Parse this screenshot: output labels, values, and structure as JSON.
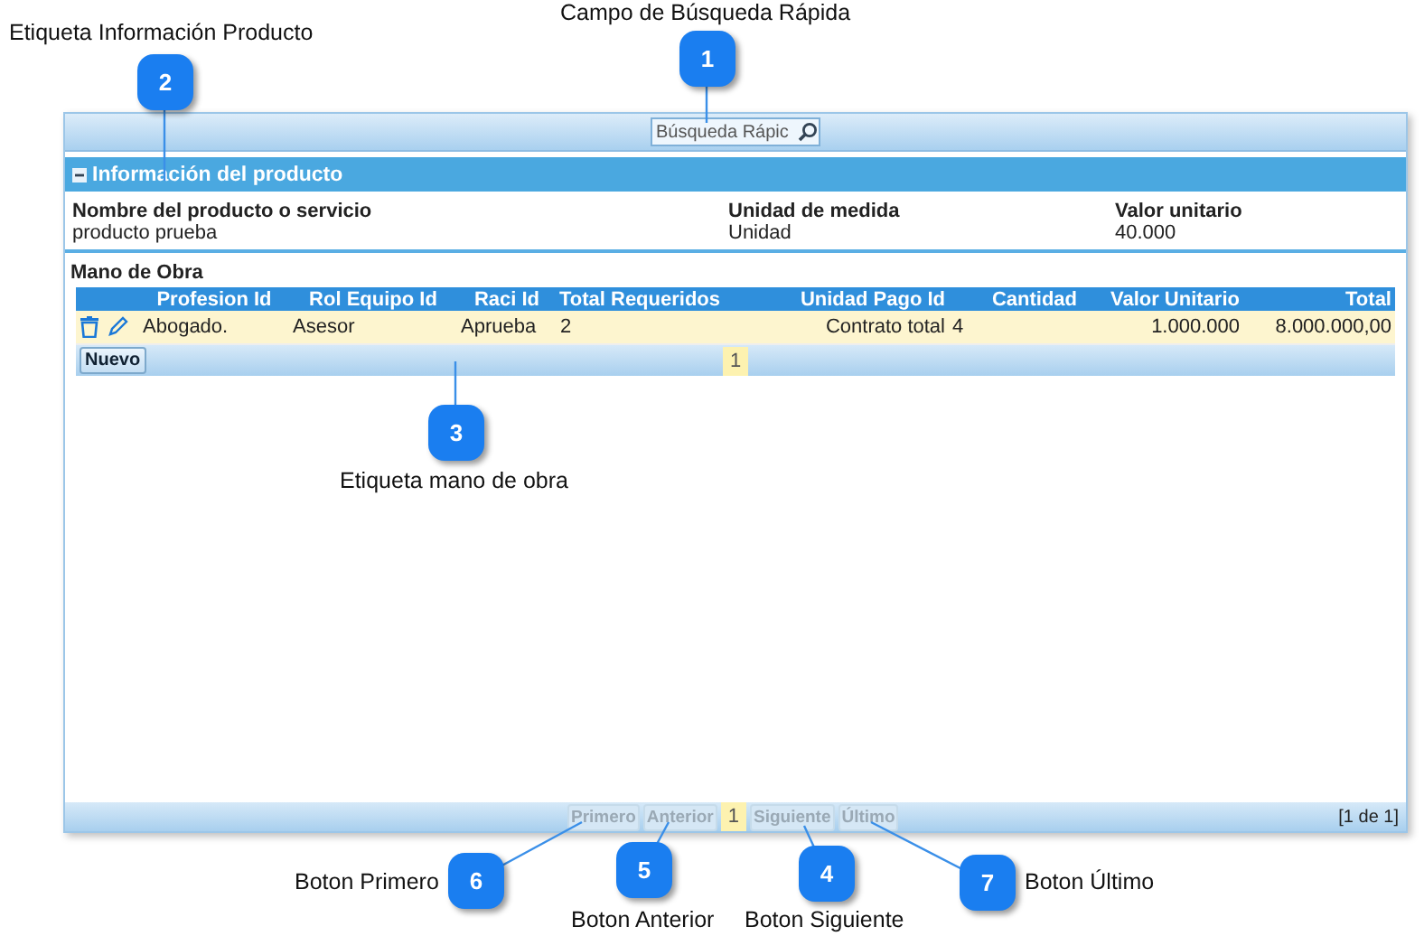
{
  "toolbar": {
    "search": {
      "placeholder": "Búsqueda Rápic"
    }
  },
  "product_section": {
    "title": "Información del producto",
    "expanded": true,
    "fields": [
      {
        "label": "Nombre del producto o servicio",
        "value": "producto prueba"
      },
      {
        "label": "Unidad de medida",
        "value": "Unidad"
      },
      {
        "label": "Valor unitario",
        "value": "40.000"
      }
    ]
  },
  "labor": {
    "title": "Mano de Obra",
    "columns": [
      "Profesion Id",
      "Rol Equipo Id",
      "Raci Id",
      "Total Requeridos",
      "Unidad Pago Id",
      "Cantidad",
      "Valor Unitario",
      "Total"
    ],
    "rows": [
      [
        "Abogado.",
        "Asesor",
        "Aprueba",
        "2",
        "Contrato total",
        "4",
        "1.000.000",
        "8.000.000,00"
      ]
    ],
    "new_button": "Nuevo",
    "page": "1"
  },
  "pager": {
    "buttons": [
      {
        "label": "Primero",
        "disabled": true
      },
      {
        "label": "Anterior",
        "disabled": true
      },
      {
        "label": "1",
        "kind": "page"
      },
      {
        "label": "Siguiente",
        "disabled": true
      },
      {
        "label": "Último",
        "disabled": true
      }
    ],
    "summary": "[1 de 1]"
  },
  "annotations": [
    {
      "number": "1",
      "label": "Campo de Búsqueda Rápida"
    },
    {
      "number": "2",
      "label": "Etiqueta Información Producto"
    },
    {
      "number": "3",
      "label": "Etiqueta mano de obra"
    },
    {
      "number": "6",
      "label": "Boton Primero"
    },
    {
      "number": "5",
      "label": "Boton Anterior"
    },
    {
      "number": "4",
      "label": "Boton Siguiente"
    },
    {
      "number": "7",
      "label": "Boton Último"
    }
  ]
}
